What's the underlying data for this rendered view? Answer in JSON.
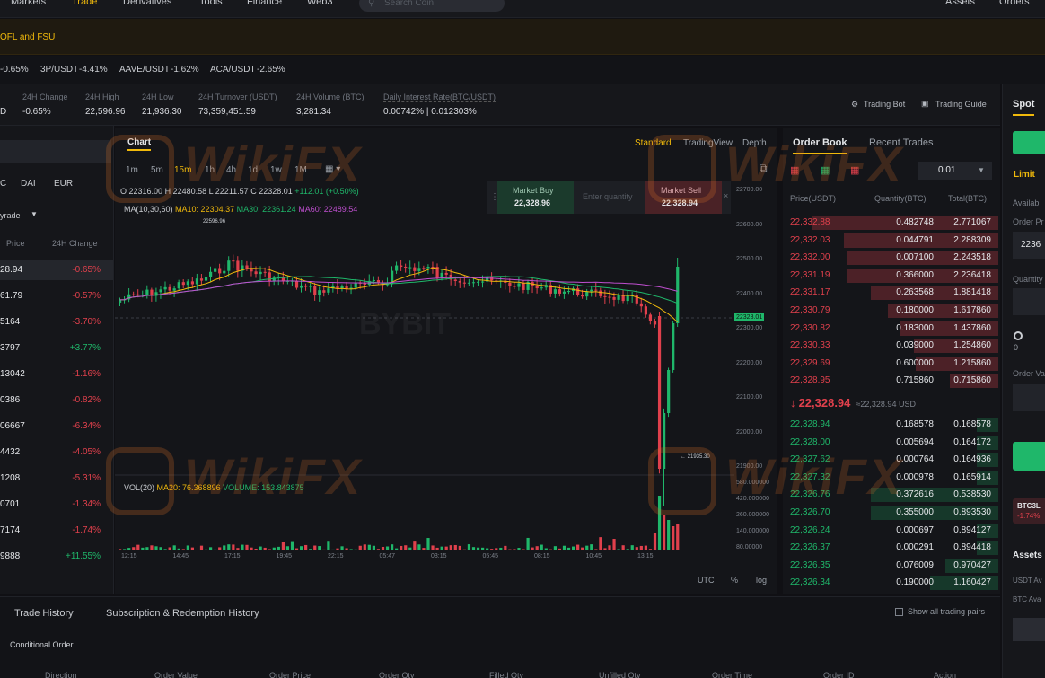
{
  "nav": {
    "items": [
      "Markets",
      "Trade",
      "Derivatives",
      "Tools",
      "Finance",
      "Web3"
    ],
    "search_placeholder": "Search Coin",
    "right_items": [
      "Assets",
      "Orders"
    ]
  },
  "announcement": "OFL and FSU",
  "ticker": [
    {
      "pair": "",
      "change": "-0.65%"
    },
    {
      "pair": "3P/USDT",
      "change": "-4.41%"
    },
    {
      "pair": "AAVE/USDT",
      "change": "-1.62%"
    },
    {
      "pair": "ACA/USDT",
      "change": "-2.65%"
    }
  ],
  "stats": {
    "price_suffix": "D",
    "change_label": "24H Change",
    "change": "-0.65%",
    "high_label": "24H High",
    "high": "22,596.96",
    "low_label": "24H Low",
    "low": "21,936.30",
    "turnover_label": "24H Turnover (USDT)",
    "turnover": "73,359,451.59",
    "volume_label": "24H Volume (BTC)",
    "volume": "3,281.34",
    "rate_label": "Daily Interest Rate(BTC/USDT)",
    "rate": "0.00742% | 0.012303%",
    "trading_bot": "Trading Bot",
    "trading_guide": "Trading Guide"
  },
  "market_list": {
    "quote_tabs": [
      "C",
      "DAI",
      "EUR"
    ],
    "filter": "yrade",
    "col_price": "Price",
    "col_change": "24H Change",
    "rows": [
      {
        "price": "28.94",
        "change": "-0.65%"
      },
      {
        "price": "61.79",
        "change": "-0.57%"
      },
      {
        "price": "5164",
        "change": "-3.70%"
      },
      {
        "price": "3797",
        "change": "+3.77%"
      },
      {
        "price": "13042",
        "change": "-1.16%"
      },
      {
        "price": "0386",
        "change": "-0.82%"
      },
      {
        "price": "06667",
        "change": "-6.34%"
      },
      {
        "price": "4432",
        "change": "-4.05%"
      },
      {
        "price": "1208",
        "change": "-5.31%"
      },
      {
        "price": "0701",
        "change": "-1.34%"
      },
      {
        "price": "7174",
        "change": "-1.74%"
      },
      {
        "price": "9888",
        "change": "+11.55%"
      }
    ]
  },
  "chart": {
    "title": "Chart",
    "views": [
      "Standard",
      "TradingView",
      "Depth"
    ],
    "timeframes": [
      "1m",
      "5m",
      "15m",
      "1h",
      "4h",
      "1d",
      "1w",
      "1M"
    ],
    "active_tf": "15m",
    "ohlc": {
      "o": "O 22316.00",
      "h": "H 22480.58",
      "l": "L 22211.57",
      "c": "C 22328.01",
      "chg": "+112.01 (+0.50%)"
    },
    "ma": {
      "label": "MA(10,30,60)",
      "ma10": "MA10: 22304.37",
      "ma30": "MA30: 22361.24",
      "ma60": "MA60: 22489.54"
    },
    "high_marker": "22596.96",
    "low_marker": "21935.30",
    "vol_label": "VOL(20)",
    "vol_ma20": "MA20: 76.368896",
    "vol_value": "VOLUME: 153.843875",
    "market_buy": "Market Buy",
    "market_buy_price": "22,328.96",
    "qty_placeholder": "Enter quantity",
    "market_sell": "Market Sell",
    "market_sell_price": "22,328.94",
    "price_axis": [
      "22700.00",
      "22600.00",
      "22500.00",
      "22400.00",
      "22300.00",
      "22200.00",
      "22100.00",
      "22000.00",
      "21900.00"
    ],
    "last_price_tag": "22328.01",
    "vol_axis": [
      "580.000000",
      "420.000000",
      "260.000000",
      "140.000000",
      "80.00000"
    ],
    "time_axis": [
      "12:15",
      "14:45",
      "17:15",
      "19:45",
      "22:15",
      "05:47",
      "03:15",
      "05:45",
      "08:15",
      "10:45",
      "13:15"
    ],
    "footer": [
      "UTC",
      "%",
      "log"
    ],
    "watermark": "BYBIT"
  },
  "order_book": {
    "tabs": [
      "Order Book",
      "Recent Trades"
    ],
    "depth": "0.01",
    "cols": [
      "Price(USDT)",
      "Quantity(BTC)",
      "Total(BTC)"
    ],
    "asks": [
      {
        "price": "22,332.88",
        "qty": "0.482748",
        "total": "2.771067",
        "fill": 0.88
      },
      {
        "price": "22,332.03",
        "qty": "0.044791",
        "total": "2.288309",
        "fill": 0.73
      },
      {
        "price": "22,332.00",
        "qty": "0.007100",
        "total": "2.243518",
        "fill": 0.71
      },
      {
        "price": "22,331.19",
        "qty": "0.366000",
        "total": "2.236418",
        "fill": 0.71
      },
      {
        "price": "22,331.17",
        "qty": "0.263568",
        "total": "1.881418",
        "fill": 0.6
      },
      {
        "price": "22,330.79",
        "qty": "0.180000",
        "total": "1.617860",
        "fill": 0.52
      },
      {
        "price": "22,330.82",
        "qty": "0.183000",
        "total": "1.437860",
        "fill": 0.46
      },
      {
        "price": "22,330.33",
        "qty": "0.039000",
        "total": "1.254860",
        "fill": 0.4
      },
      {
        "price": "22,329.69",
        "qty": "0.600000",
        "total": "1.215860",
        "fill": 0.39
      },
      {
        "price": "22,328.95",
        "qty": "0.715860",
        "total": "0.715860",
        "fill": 0.23
      }
    ],
    "mid_price": "22,328.94",
    "mid_usd": "≈22,328.94 USD",
    "bids": [
      {
        "price": "22,328.94",
        "qty": "0.168578",
        "total": "0.168578",
        "fill": 0.1
      },
      {
        "price": "22,328.00",
        "qty": "0.005694",
        "total": "0.164172",
        "fill": 0.1
      },
      {
        "price": "22,327.62",
        "qty": "0.000764",
        "total": "0.164936",
        "fill": 0.1
      },
      {
        "price": "22,327.32",
        "qty": "0.000978",
        "total": "0.165914",
        "fill": 0.1
      },
      {
        "price": "22,326.76",
        "qty": "0.372616",
        "total": "0.538530",
        "fill": 0.6
      },
      {
        "price": "22,326.70",
        "qty": "0.355000",
        "total": "0.893530",
        "fill": 0.6
      },
      {
        "price": "22,326.24",
        "qty": "0.000697",
        "total": "0.894127",
        "fill": 0.1
      },
      {
        "price": "22,326.37",
        "qty": "0.000291",
        "total": "0.894418",
        "fill": 0.1
      },
      {
        "price": "22,326.35",
        "qty": "0.076009",
        "total": "0.970427",
        "fill": 0.25
      },
      {
        "price": "22,326.34",
        "qty": "0.190000",
        "total": "1.160427",
        "fill": 0.32
      }
    ]
  },
  "right": {
    "spot": "Spot",
    "limit": "Limit",
    "available": "Availab",
    "order_price": "Order Pr",
    "price_value": "2236",
    "quantity": "Quantity",
    "order_value": "Order Va",
    "pair": "BTC3L",
    "pair_change": "-1.74%",
    "assets": "Assets",
    "usdt": "USDT Av",
    "btc": "BTC Ava"
  },
  "bottom": {
    "tabs": [
      "Trade History",
      "Subscription & Redemption History"
    ],
    "show_all": "Show all trading pairs",
    "conditional": "Conditional Order",
    "cols": [
      "Direction",
      "Order Value",
      "Order Price",
      "Order Qty",
      "Filled Qty",
      "Unfilled Qty",
      "Order Time",
      "Order ID",
      "Action"
    ]
  },
  "watermark": "WikiFX",
  "colors": {
    "up": "#1fb76a",
    "down": "#e0404c",
    "accent": "#f0b90b"
  }
}
